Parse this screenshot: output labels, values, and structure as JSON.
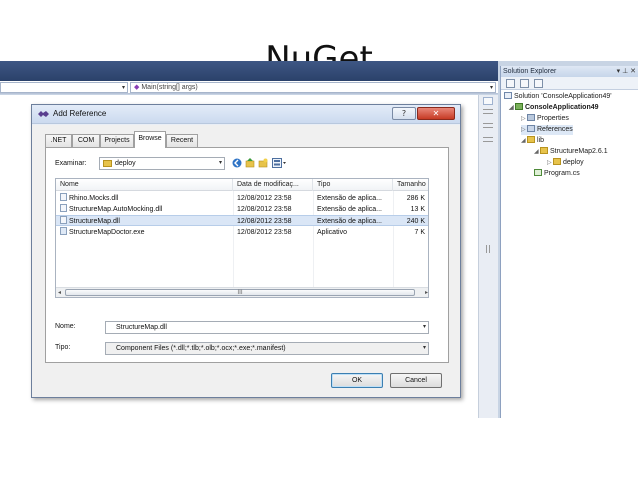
{
  "slide": {
    "title": "NuGet"
  },
  "editor": {
    "method_combo": "Main(string[] args)"
  },
  "solution_explorer": {
    "title": "Solution Explorer",
    "title_buttons": "▾ ⊥ ✕",
    "tree": [
      {
        "label": "Solution 'ConsoleApplication49'",
        "bold": false
      },
      {
        "label": "ConsoleApplication49",
        "bold": true
      },
      {
        "label": "Properties",
        "bold": false
      },
      {
        "label": "References",
        "bold": false
      },
      {
        "label": "lib",
        "bold": false
      },
      {
        "label": "StructureMap2.6.1",
        "bold": false
      },
      {
        "label": "deploy",
        "bold": false
      },
      {
        "label": "Program.cs",
        "bold": false
      }
    ]
  },
  "dialog": {
    "title": "Add Reference",
    "help_glyph": "?",
    "close_glyph": "✕",
    "tabs": [
      ".NET",
      "COM",
      "Projects",
      "Browse",
      "Recent"
    ],
    "active_tab": "Browse",
    "look_in_label": "Examinar:",
    "look_in_value": "deploy",
    "columns": [
      "Nome",
      "Data de modificaç...",
      "Tipo",
      "Tamanho"
    ],
    "files": [
      {
        "name": "Rhino.Mocks.dll",
        "date": "12/08/2012 23:58",
        "type": "Extensão de aplica...",
        "size": "286 K"
      },
      {
        "name": "StructureMap.AutoMocking.dll",
        "date": "12/08/2012 23:58",
        "type": "Extensão de aplica...",
        "size": "13 K"
      },
      {
        "name": "StructureMap.dll",
        "date": "12/08/2012 23:58",
        "type": "Extensão de aplica...",
        "size": "240 K"
      },
      {
        "name": "StructureMapDoctor.exe",
        "date": "12/08/2012 23:58",
        "type": "Aplicativo",
        "size": "7 K"
      }
    ],
    "selected_file": "StructureMap.dll",
    "scroll_thumb_glyph": "III",
    "file_name_label": "Nome:",
    "file_name_value": "StructureMap.dll",
    "file_type_label": "Tipo:",
    "file_type_value": "Component Files (*.dll;*.tlb;*.olb;*.ocx;*.exe;*.manifest)",
    "ok_label": "OK",
    "cancel_label": "Cancel"
  },
  "colors": {
    "titlebar": "#2b416a",
    "selection": "#dae6f6",
    "close_button": "#c63a24",
    "folder": "#e7c34b"
  }
}
